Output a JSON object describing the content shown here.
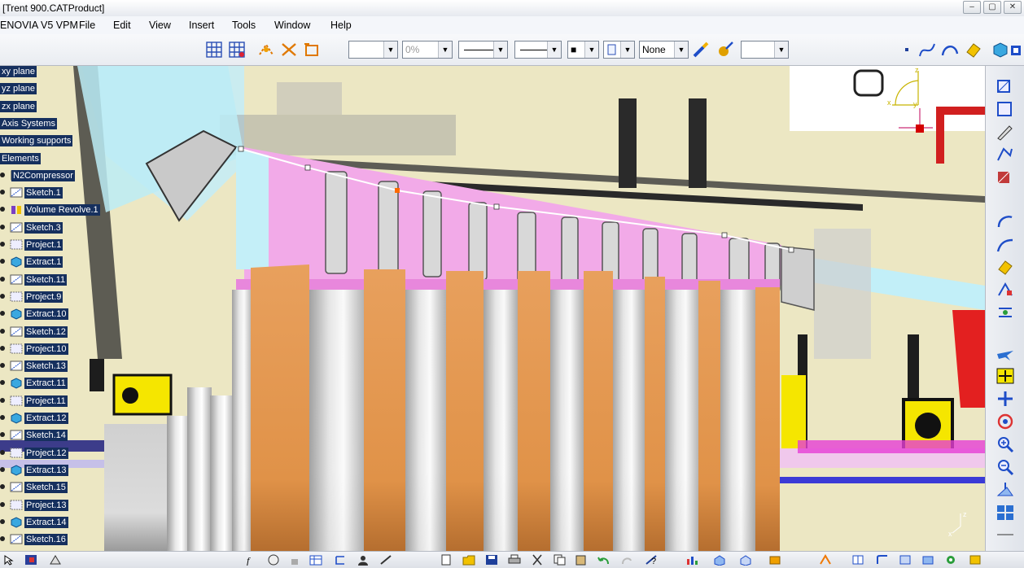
{
  "window": {
    "title": "[Trent 900.CATProduct]",
    "buttons": [
      "–",
      "▢",
      "✕"
    ]
  },
  "menubar": {
    "brand": "ENOVIA V5 VPM",
    "items": [
      "File",
      "Edit",
      "View",
      "Insert",
      "Tools",
      "Window",
      "Help"
    ]
  },
  "toolbar": {
    "color_combo": "",
    "transparency_combo": "0%",
    "linetype_combo": "",
    "thickness_combo": "",
    "point_combo": "■",
    "layer_combo": "None",
    "last_combo": ""
  },
  "tree": {
    "items": [
      {
        "label": "xy plane",
        "icon": "plane-icon"
      },
      {
        "label": "yz plane",
        "icon": "plane-icon"
      },
      {
        "label": "zx plane",
        "icon": "plane-icon"
      },
      {
        "label": "Axis Systems",
        "icon": "axis-icon"
      },
      {
        "label": "Working supports",
        "icon": "support-icon"
      },
      {
        "label": "Elements",
        "icon": "elements-icon"
      },
      {
        "label": "N2Compressor",
        "icon": "part-icon"
      },
      {
        "label": "Sketch.1",
        "icon": "sketch-icon"
      },
      {
        "label": "Volume Revolve.1",
        "icon": "revolve-icon"
      },
      {
        "label": "Sketch.3",
        "icon": "sketch-icon"
      },
      {
        "label": "Project.1",
        "icon": "project-icon"
      },
      {
        "label": "Extract.1",
        "icon": "extract-icon"
      },
      {
        "label": "Sketch.11",
        "icon": "sketch-icon"
      },
      {
        "label": "Project.9",
        "icon": "project-icon"
      },
      {
        "label": "Extract.10",
        "icon": "extract-icon"
      },
      {
        "label": "Sketch.12",
        "icon": "sketch-icon"
      },
      {
        "label": "Project.10",
        "icon": "project-icon"
      },
      {
        "label": "Sketch.13",
        "icon": "sketch-icon"
      },
      {
        "label": "Extract.11",
        "icon": "extract-icon"
      },
      {
        "label": "Project.11",
        "icon": "project-icon"
      },
      {
        "label": "Extract.12",
        "icon": "extract-icon"
      },
      {
        "label": "Sketch.14",
        "icon": "sketch-icon"
      },
      {
        "label": "Project.12",
        "icon": "project-icon"
      },
      {
        "label": "Extract.13",
        "icon": "extract-icon"
      },
      {
        "label": "Sketch.15",
        "icon": "sketch-icon"
      },
      {
        "label": "Project.13",
        "icon": "project-icon"
      },
      {
        "label": "Extract.14",
        "icon": "extract-icon"
      },
      {
        "label": "Sketch.16",
        "icon": "sketch-icon"
      }
    ]
  },
  "compass": {
    "x_label": "x",
    "y_label": "y",
    "z_label": "z"
  },
  "colors": {
    "tree_label_bg": "#16305e",
    "blade_orange": "#e2964f",
    "pink": "#f0a8e4",
    "cyan": "#bdf0fa",
    "beige": "#ece7c3"
  }
}
